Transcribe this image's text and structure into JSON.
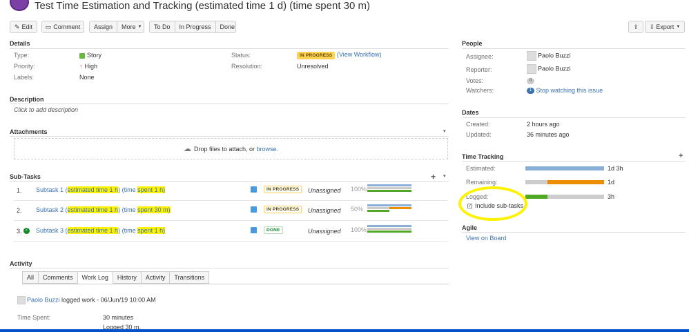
{
  "header": {
    "title": "Test Time Estimation and Tracking (estimated time 1 d) (time spent 30 m)"
  },
  "toolbar": {
    "edit": "Edit",
    "comment": "Comment",
    "assign": "Assign",
    "more": "More",
    "todo": "To Do",
    "in_progress": "In Progress",
    "done": "Done",
    "export": "Export"
  },
  "details": {
    "heading": "Details",
    "type_label": "Type:",
    "type_value": "Story",
    "priority_label": "Priority:",
    "priority_value": "High",
    "labels_label": "Labels:",
    "labels_value": "None",
    "status_label": "Status:",
    "status_value": "IN PROGRESS",
    "status_link": "(View Workflow)",
    "resolution_label": "Resolution:",
    "resolution_value": "Unresolved"
  },
  "description": {
    "heading": "Description",
    "placeholder": "Click to add description"
  },
  "attachments": {
    "heading": "Attachments",
    "drop_text": "Drop files to attach, or",
    "browse": "browse."
  },
  "subtasks": {
    "heading": "Sub-Tasks",
    "items": [
      {
        "num": "1.",
        "name_a": "Subtask 1 (",
        "hl1": "estimated time 1 h",
        "mid": ") (time ",
        "hl2": "spent 1 h)",
        "status": "IN PROGRESS",
        "assignee": "Unassigned",
        "pct": "100%"
      },
      {
        "num": "2.",
        "name_a": "Subtask 2 (",
        "hl1": "estimated time 1 h",
        "mid": ") (time ",
        "hl2": "spent 30 m)",
        "status": "IN PROGRESS",
        "assignee": "Unassigned",
        "pct": "50%"
      },
      {
        "num": "3.",
        "name_a": "Subtask 3 (",
        "hl1": "estimated time 1 h",
        "mid": ") (time ",
        "hl2": "spent 1 h)",
        "status": "DONE",
        "assignee": "Unassigned",
        "pct": "100%"
      }
    ]
  },
  "activity": {
    "heading": "Activity",
    "tabs": [
      "All",
      "Comments",
      "Work Log",
      "History",
      "Activity",
      "Transitions"
    ],
    "log_user": "Paolo Buzzi",
    "log_text": "logged work - 06/Jun/19 10:00 AM",
    "time_spent_label": "Time Spent:",
    "time_spent_value": "30 minutes",
    "logged_text": "Logged 30 m."
  },
  "people": {
    "heading": "People",
    "assignee_label": "Assignee:",
    "assignee_value": "Paolo Buzzi",
    "reporter_label": "Reporter:",
    "reporter_value": "Paolo Buzzi",
    "votes_label": "Votes:",
    "votes_value": "0",
    "watchers_label": "Watchers:",
    "watchers_count": "1",
    "watchers_link": "Stop watching this issue"
  },
  "dates": {
    "heading": "Dates",
    "created_label": "Created:",
    "created_value": "2 hours ago",
    "updated_label": "Updated:",
    "updated_value": "36 minutes ago"
  },
  "time_tracking": {
    "heading": "Time Tracking",
    "estimated_label": "Estimated:",
    "estimated_value": "1d 3h",
    "remaining_label": "Remaining:",
    "remaining_value": "1d",
    "logged_label": "Logged:",
    "logged_value": "3h",
    "include_subtasks": "Include sub-tasks"
  },
  "agile": {
    "heading": "Agile",
    "link": "View on Board"
  },
  "colors": {
    "estimated": "#89afd7",
    "remaining": "#ec8e00",
    "logged": "#51a825",
    "empty": "#cccccc",
    "highlight": "#fff200"
  }
}
